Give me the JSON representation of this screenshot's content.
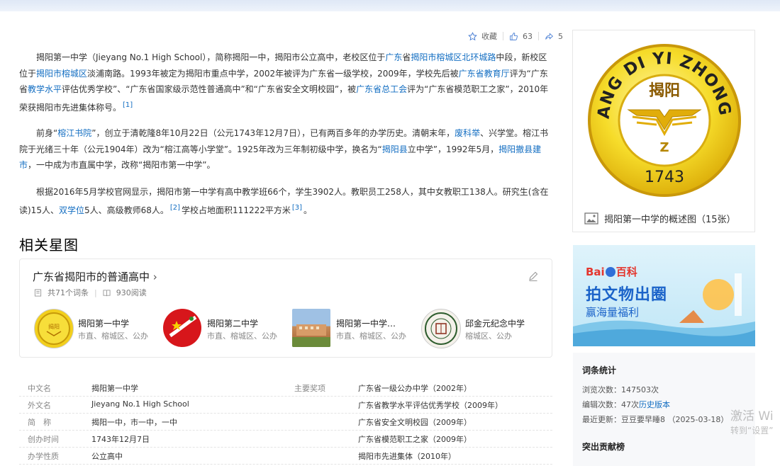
{
  "actions": {
    "favorite_label": "收藏",
    "like_count": "63",
    "share_count": "5"
  },
  "paragraphs": {
    "p1": {
      "t1": "揭阳第一中学（Jieyang No.1 High School），简称揭阳一中，揭阳市公立高中，老校区位于",
      "l1": "广东",
      "t2": "省",
      "l2": "揭阳市榕城区北环城路",
      "t3": "中段，新校区位于",
      "l3": "揭阳市榕城区",
      "t4": "淡浦南路。1993年被定为揭阳市重点中学，2002年被评为广东省一级学校，2009年，学校先后被",
      "l4": "广东省教育厅",
      "t5": "评为“广东省",
      "l5": "教学水平",
      "t6": "评估优秀学校”、“广东省国家级示范性普通高中”和“广东省安全文明校园”，被",
      "l6": "广东省总工会",
      "t7": "评为“广东省模范职工之家”，2010年荣获揭阳市先进集体称号。",
      "ref": "[1]"
    },
    "p2": {
      "t1": "前身“",
      "l1": "榕江书院",
      "t2": "”，创立于清乾隆8年10月22日（公元1743年12月7日），已有两百多年的办学历史。清朝末年，",
      "l2": "废科举",
      "t3": "、兴学堂。榕江书院于光绪三十年（公元1904年）改为“榕江高等小学堂”。1925年改为三年制初级中学，换名为“",
      "l3": "揭阳县",
      "t4": "立中学”，1992年5月，",
      "l4": "揭阳撤县建市",
      "t5": "，一中成为市直属中学，改称“揭阳市第一中学”。"
    },
    "p3": {
      "t1": "根据2016年5月学校官网显示，揭阳市第一中学有高中教学班66个，学生3902人。教职员工258人，其中女教职工138人。研究生(含在读)15人、",
      "l1": "双学位",
      "t2": "5人、高级教师68人。",
      "ref1": "[2]",
      "t3": "学校占地面积111222平方米",
      "ref2": "[3]",
      "t4": "。"
    }
  },
  "section_title": "相关星图",
  "star_card": {
    "title": "广东省揭阳市的普通高中",
    "chevron": "›",
    "entry_count": "共71个词条",
    "read_count": "930阅读",
    "schools": [
      {
        "name": "揭阳第一中学",
        "sub": "市直、榕城区、公办"
      },
      {
        "name": "揭阳第二中学",
        "sub": "市直、榕城区、公办"
      },
      {
        "name": "揭阳第一中学…",
        "sub": "市直、榕城区、公办"
      },
      {
        "name": "邱金元纪念中学",
        "sub": "榕城区、公办"
      }
    ]
  },
  "infobox": {
    "rows": [
      {
        "k1": "中文名",
        "v1": "揭阳第一中学",
        "k2": "主要奖项",
        "v2": "广东省一级公办中学（2002年）"
      },
      {
        "k1": "外文名",
        "v1": "Jieyang No.1 High School",
        "k2": "",
        "v2": "广东省教学水平评估优秀学校（2009年）"
      },
      {
        "k1": "简　称",
        "v1": "揭阳一中，市一中，一中",
        "k2": "",
        "v2": "广东省安全文明校园（2009年）"
      },
      {
        "k1": "创办时间",
        "v1": "1743年12月7日",
        "k2": "",
        "v2": "广东省模范职工之家（2009年）"
      },
      {
        "k1": "办学性质",
        "v1": "公立高中",
        "k2": "",
        "v2": "揭阳市先进集体（2010年）"
      }
    ]
  },
  "logo": {
    "arc_text": "JIE YANG DI YI ZHONG XUE",
    "center_text": "揭阳",
    "year": "1743",
    "letter": "Z"
  },
  "image_caption": "揭阳第一中学的概述图（15张）",
  "ad": {
    "brand_a": "Bai",
    "brand_b": "百科",
    "headline": "拍文物出圈",
    "sub": "赢海量福利"
  },
  "stats": {
    "heading": "词条统计",
    "views": "浏览次数：147503次",
    "edits_prefix": "编辑次数：47次",
    "history_link": "历史版本",
    "updated": "最近更新：豆豆要早睡8 （2025-03-18）",
    "contributors_heading": "突出贡献榜"
  },
  "watermark": {
    "line1": "激活 Wi",
    "line2": "转到“设置”"
  },
  "colors": {
    "link": "#136ec2",
    "logo_gold": "#f3d21a",
    "logo_ring": "#e2b80c"
  }
}
